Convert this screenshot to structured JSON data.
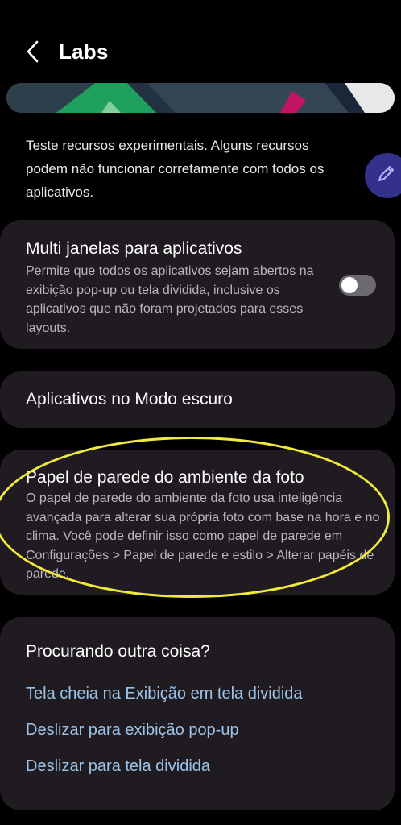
{
  "header": {
    "title": "Labs",
    "back_icon": "chevron-left-icon"
  },
  "intro": {
    "text": "Teste recursos experimentais. Alguns recursos podem não funcionar corretamente com todos os aplicativos."
  },
  "fab": {
    "icon": "pen-icon",
    "color": "#33318c"
  },
  "cards": {
    "multi_window": {
      "title": "Multi janelas para aplicativos",
      "description": "Permite que todos os aplicativos sejam abertos na exibição pop-up ou tela dividida, inclusive os aplicativos que não foram projetados para esses layouts.",
      "toggle_on": false
    },
    "dark_mode": {
      "title": "Aplicativos no Modo escuro"
    },
    "photo_ambient": {
      "title": "Papel de parede do ambiente da foto",
      "description": "O papel de parede do ambiente da foto usa inteligência avançada para alterar sua própria foto com base na hora e no clima. Você pode definir isso como papel de parede em Configurações > Papel de parede e estilo > Alterar papéis de parede."
    }
  },
  "looking_for": {
    "title": "Procurando outra coisa?",
    "links": [
      "Tela cheia na Exibição em tela dividida",
      "Deslizar para exibição pop-up",
      "Deslizar para tela dividida"
    ]
  },
  "colors": {
    "background": "#000000",
    "card": "#1f1b20",
    "link": "#9cc3ea",
    "highlight": "#f1ea3c"
  }
}
